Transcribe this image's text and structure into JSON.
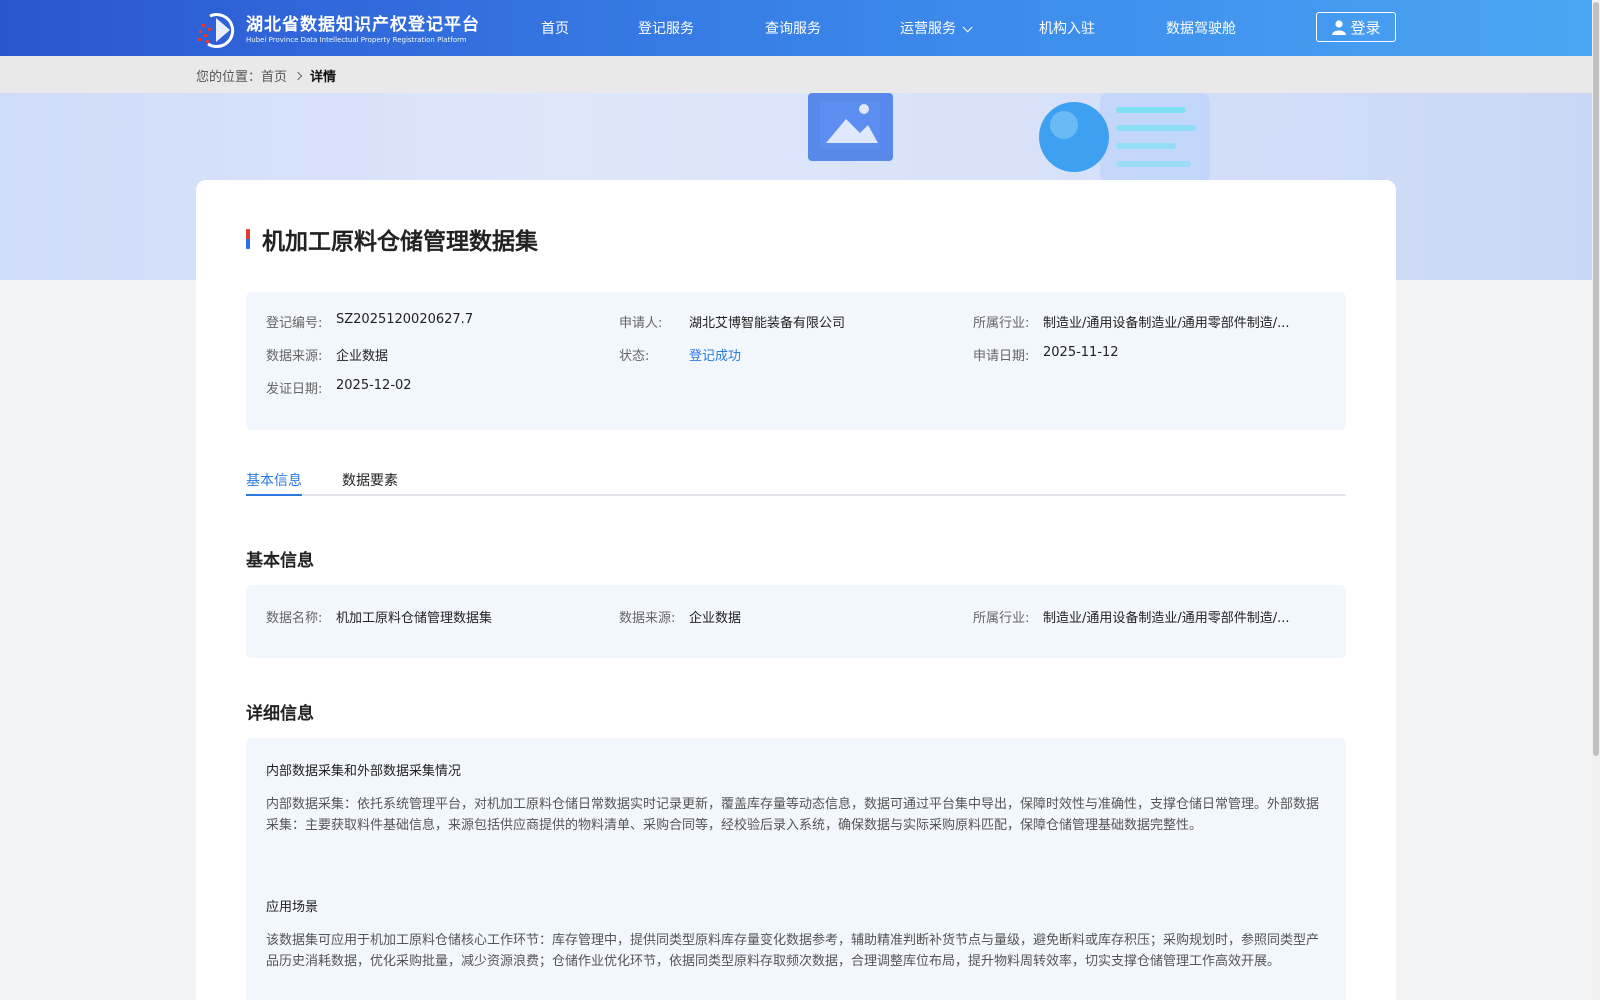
{
  "header": {
    "logo_cn": "湖北省数据知识产权登记平台",
    "logo_en": "Hubei Province Data Intellectual Property Registration Platform",
    "nav": [
      "首页",
      "登记服务",
      "查询服务",
      "运营服务",
      "机构入驻",
      "数据驾驶舱"
    ],
    "login_label": "登录"
  },
  "breadcrumb": {
    "prefix": "您的位置：",
    "home": "首页",
    "current": "详情"
  },
  "detail": {
    "title": "机加工原料仓储管理数据集",
    "summary": {
      "reg_no_label": "登记编号:",
      "reg_no": "SZ2025120020627.7",
      "applicant_label": "申请人:",
      "applicant": "湖北艾博智能装备有限公司",
      "industry_label": "所属行业:",
      "industry": "制造业/通用设备制造业/通用零部件制造/...",
      "source_label": "数据来源:",
      "source": "企业数据",
      "status_label": "状态:",
      "status": "登记成功",
      "apply_date_label": "申请日期:",
      "apply_date": "2025-11-12",
      "issue_date_label": "发证日期:",
      "issue_date": "2025-12-02"
    },
    "tabs": [
      "基本信息",
      "数据要素"
    ],
    "basic": {
      "heading": "基本信息",
      "name_label": "数据名称:",
      "name": "机加工原料仓储管理数据集",
      "source_label": "数据来源:",
      "source": "企业数据",
      "industry_label": "所属行业:",
      "industry": "制造业/通用设备制造业/通用零部件制造/..."
    },
    "more": {
      "heading": "详细信息",
      "collect_title": "内部数据采集和外部数据采集情况",
      "collect_text": "内部数据采集：依托系统管理平台，对机加工原料仓储日常数据实时记录更新，覆盖库存量等动态信息，数据可通过平台集中导出，保障时效性与准确性，支撑仓储日常管理。外部数据采集：主要获取料件基础信息，来源包括供应商提供的物料清单、采购合同等，经校验后录入系统，确保数据与实际采购原料匹配，保障仓储管理基础数据完整性。",
      "scene_title": "应用场景",
      "scene_text": "该数据集可应用于机加工原料仓储核心工作环节：库存管理中，提供同类型原料库存量变化数据参考，辅助精准判断补货节点与量级，避免断料或库存积压；采购规划时，参照同类型产品历史消耗数据，优化采购批量，减少资源浪费；仓储作业优化环节，依据同类型原料存取频次数据，合理调整库位布局，提升物料周转效率，切实支撑仓储管理工作高效开展。"
    }
  }
}
